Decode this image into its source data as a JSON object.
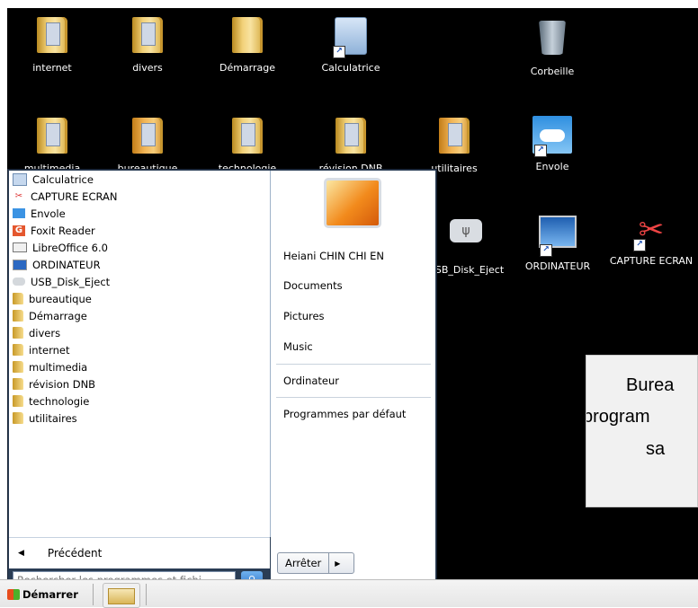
{
  "desktop": {
    "icons": [
      {
        "label": "internet"
      },
      {
        "label": "divers"
      },
      {
        "label": "Démarrage"
      },
      {
        "label": "Calculatrice"
      },
      {
        "label": "Corbeille"
      },
      {
        "label": "multimedia"
      },
      {
        "label": "bureautique"
      },
      {
        "label": "technologie"
      },
      {
        "label": "révision DNB"
      },
      {
        "label": "utilitaires"
      },
      {
        "label": "Envole"
      },
      {
        "label": "USB_Disk_Eject"
      },
      {
        "label": "ORDINATEUR"
      },
      {
        "label": "CAPTURE ECRAN"
      }
    ]
  },
  "start_menu": {
    "programs": [
      {
        "label": "Calculatrice",
        "icon": "calculator-icon"
      },
      {
        "label": "CAPTURE ECRAN",
        "icon": "capture-icon"
      },
      {
        "label": "Envole",
        "icon": "envole-icon"
      },
      {
        "label": "Foxit Reader",
        "icon": "foxit-icon"
      },
      {
        "label": "LibreOffice 6.0",
        "icon": "libreoffice-icon"
      },
      {
        "label": "ORDINATEUR",
        "icon": "computer-icon"
      },
      {
        "label": "USB_Disk_Eject",
        "icon": "usb-icon"
      },
      {
        "label": "bureautique",
        "icon": "folder-icon"
      },
      {
        "label": "Démarrage",
        "icon": "folder-icon"
      },
      {
        "label": "divers",
        "icon": "folder-icon"
      },
      {
        "label": "internet",
        "icon": "folder-icon"
      },
      {
        "label": "multimedia",
        "icon": "folder-icon"
      },
      {
        "label": "révision DNB",
        "icon": "folder-icon"
      },
      {
        "label": "technologie",
        "icon": "folder-icon"
      },
      {
        "label": "utilitaires",
        "icon": "folder-icon"
      }
    ],
    "back_label": "Précédent",
    "search_placeholder": "Rechercher les programmes et fichi...",
    "right_links": {
      "user": "Heiani CHIN CHI EN",
      "documents": "Documents",
      "pictures": "Pictures",
      "music": "Music",
      "ordinateur": "Ordinateur",
      "default_programs": "Programmes par défaut"
    },
    "shutdown_label": "Arrêter"
  },
  "callout": {
    "line1": "Burea",
    "line2": "program",
    "line3": "sa"
  },
  "taskbar": {
    "start_label": "Démarrer"
  },
  "colors": {
    "desktop_bg": "#000000",
    "start_menu_frame": "#2a3d55"
  }
}
